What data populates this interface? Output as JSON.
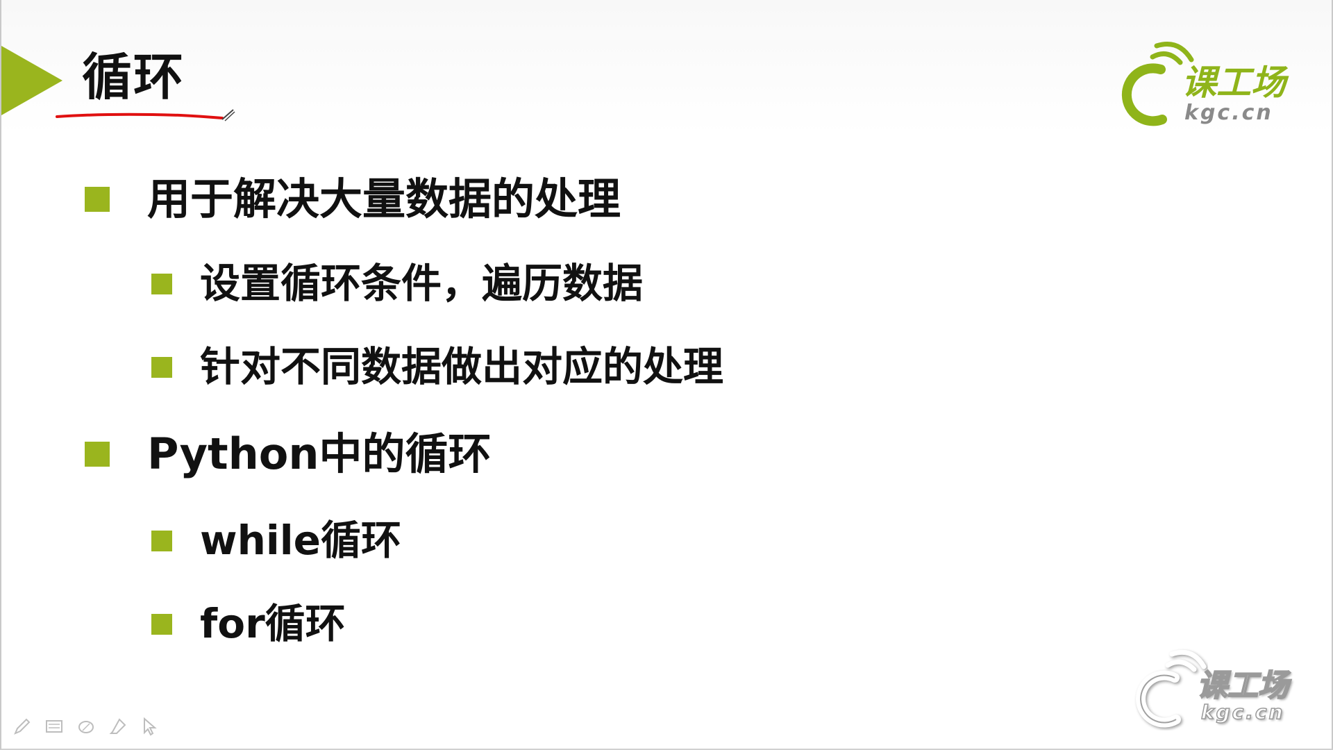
{
  "slide": {
    "title": "循环"
  },
  "bullets": [
    {
      "level": 1,
      "text": "用于解决大量数据的处理"
    },
    {
      "level": 2,
      "text": "设置循环条件，遍历数据"
    },
    {
      "level": 2,
      "text": "针对不同数据做出对应的处理"
    },
    {
      "level": 1,
      "text": "Python中的循环"
    },
    {
      "level": 2,
      "text": "while循环"
    },
    {
      "level": 2,
      "text": "for循环"
    }
  ],
  "logo": {
    "name": "课工场",
    "domain": "kgc.cn"
  },
  "colors": {
    "accent": "#9ab51e",
    "text": "#111111",
    "annotation": "#e01010"
  },
  "toolbar": {
    "icons": [
      "pen-icon",
      "slides-icon",
      "eraser-icon",
      "highlighter-icon",
      "pointer-icon"
    ]
  }
}
